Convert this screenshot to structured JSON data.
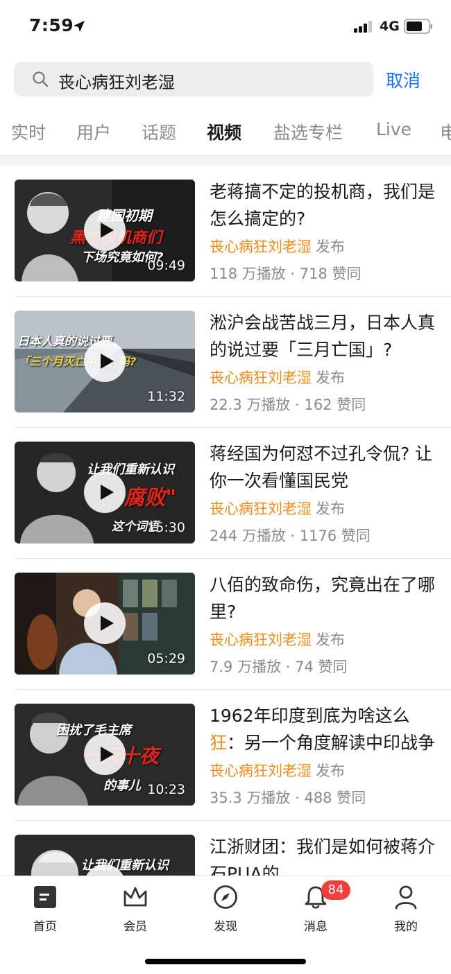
{
  "status_bar": {
    "time": "7:59",
    "network": "4G"
  },
  "search": {
    "query": "丧心病狂刘老湿",
    "cancel_label": "取消"
  },
  "tabs": [
    {
      "label": "实时"
    },
    {
      "label": "用户"
    },
    {
      "label": "话题"
    },
    {
      "label": "视频",
      "active": true
    },
    {
      "label": "盐选专栏"
    },
    {
      "label": "Live"
    },
    {
      "label": "电"
    }
  ],
  "results": [
    {
      "thumb_lines": [
        "建国初期",
        "黑市投机商们",
        "下场究竟如何?"
      ],
      "duration": "09:49",
      "title": "老蒋搞不定的投机商，我们是怎么搞定的?",
      "author": "丧心病狂刘老湿",
      "publish_label": "发布",
      "stats": "118 万播放 · 718 赞同"
    },
    {
      "thumb_lines": [
        "日本人真的说过要",
        "「三个月灭亡中国」吗?"
      ],
      "duration": "11:32",
      "title": "淞沪会战苦战三月，日本人真的说过要「三月亡国」?",
      "author": "丧心病狂刘老湿",
      "publish_label": "发布",
      "stats": "22.3 万播放 · 162 赞同"
    },
    {
      "thumb_lines": [
        "让我们重新认识",
        "\"腐败\"",
        "这个词语"
      ],
      "duration": "15:30",
      "title": "蒋经国为何怼不过孔令侃? 让你一次看懂国民党",
      "author": "丧心病狂刘老湿",
      "publish_label": "发布",
      "stats": "244 万播放 · 1176 赞同"
    },
    {
      "thumb_lines": [],
      "duration": "05:29",
      "title": "八佰的致命伤，究竟出在了哪里?",
      "author": "丧心病狂刘老湿",
      "publish_label": "发布",
      "stats": "7.9 万播放 · 74 赞同"
    },
    {
      "thumb_lines": [
        "困扰了毛主席",
        "一天十夜",
        "的事儿"
      ],
      "duration": "10:23",
      "title_prefix": "1962年印度到底为啥这么",
      "title_highlight": "狂",
      "title_suffix": "：另一个角度解读中印战争",
      "author": "丧心病狂刘老湿",
      "publish_label": "发布",
      "stats": "35.3 万播放 · 488 赞同"
    },
    {
      "thumb_lines": [
        "让我们重新认识"
      ],
      "duration": "",
      "title": "江浙财团：我们是如何被蒋介石PUA的",
      "author": "",
      "publish_label": "",
      "stats": ""
    }
  ],
  "bottom_nav": [
    {
      "label": "首页",
      "icon": "home-icon"
    },
    {
      "label": "会员",
      "icon": "crown-icon"
    },
    {
      "label": "发现",
      "icon": "compass-icon"
    },
    {
      "label": "消息",
      "icon": "bell-icon",
      "badge": "84"
    },
    {
      "label": "我的",
      "icon": "person-icon"
    }
  ],
  "colors": {
    "accent": "#1772f6",
    "highlight": "#f08c1a",
    "badge": "#f1403c"
  }
}
